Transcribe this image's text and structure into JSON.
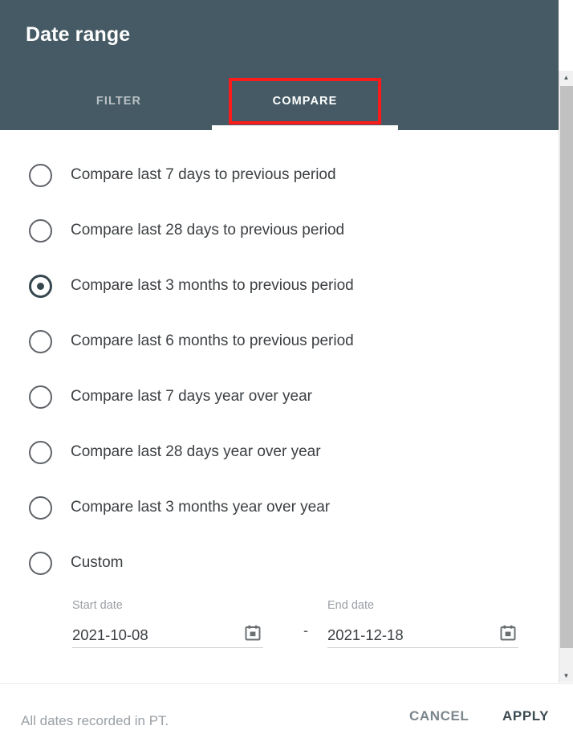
{
  "header": {
    "title": "Date range",
    "bg_color": "#455a64",
    "tabs": [
      {
        "label": "FILTER",
        "active": false
      },
      {
        "label": "COMPARE",
        "active": true
      }
    ],
    "highlight_color": "#fb1b1b"
  },
  "options": [
    {
      "label": "Compare last 7 days to previous period",
      "selected": false
    },
    {
      "label": "Compare last 28 days to previous period",
      "selected": false
    },
    {
      "label": "Compare last 3 months to previous period",
      "selected": true
    },
    {
      "label": "Compare last 6 months to previous period",
      "selected": false
    },
    {
      "label": "Compare last 7 days year over year",
      "selected": false
    },
    {
      "label": "Compare last 28 days year over year",
      "selected": false
    },
    {
      "label": "Compare last 3 months year over year",
      "selected": false
    },
    {
      "label": "Custom",
      "selected": false
    }
  ],
  "dates": {
    "start_caption": "Start date",
    "start_value": "2021-10-08",
    "separator": "-",
    "end_caption": "End date",
    "end_value": "2021-12-18",
    "calendar_icon": "calendar-icon"
  },
  "scrollbar": {
    "up_icon": "scroll-up-arrow-icon",
    "down_icon": "scroll-down-arrow-icon"
  },
  "footer": {
    "note": "All dates recorded in PT.",
    "cancel_label": "CANCEL",
    "apply_label": "APPLY"
  }
}
